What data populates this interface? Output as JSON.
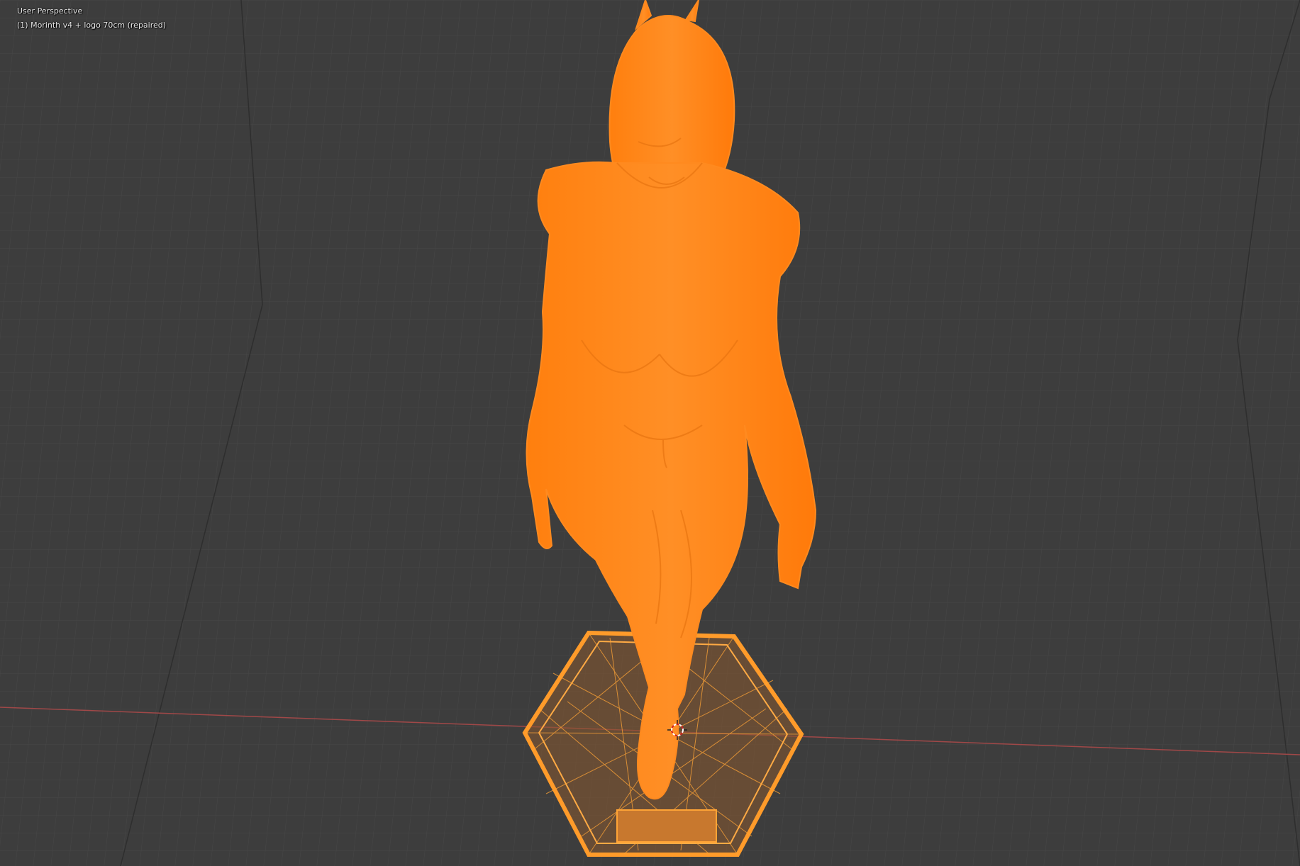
{
  "viewport": {
    "view_name": "User Perspective",
    "object_label": "(1) Morinth v4 + logo 70cm (repaired)",
    "grid_color": "#454545",
    "background_color": "#3d3d3d",
    "x_axis_color": "#a04848",
    "selection_color": "#ff8a1f",
    "wire_color": "#ffa436"
  },
  "scene": {
    "object_icon": "character-mesh-icon",
    "base_icon": "hexagon-base-icon",
    "cursor_icon": "3d-cursor-icon"
  }
}
